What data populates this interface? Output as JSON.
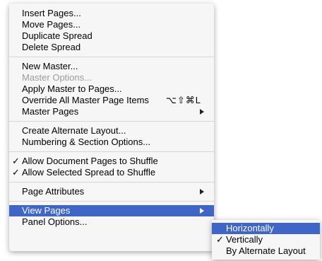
{
  "menu": {
    "group1": [
      "Insert Pages...",
      "Move Pages...",
      "Duplicate Spread",
      "Delete Spread"
    ],
    "group2": {
      "new_master": "New Master...",
      "master_options": "Master Options...",
      "apply_master": "Apply Master to Pages...",
      "override_all": "Override All Master Page Items",
      "override_shortcut": "⌥⇧⌘L",
      "master_pages": "Master Pages"
    },
    "group3": [
      "Create Alternate Layout...",
      "Numbering & Section Options..."
    ],
    "group4": {
      "allow_doc_shuffle": "Allow Document Pages to Shuffle",
      "allow_spread_shuffle": "Allow Selected Spread to Shuffle",
      "check": "✓"
    },
    "page_attributes": "Page Attributes",
    "view_pages": "View Pages",
    "panel_options": "Panel Options..."
  },
  "submenu": {
    "items": [
      "Horizontally",
      "Vertically",
      "By Alternate Layout"
    ],
    "check": "✓"
  },
  "colors": {
    "highlight": "#3f65c9",
    "menu_bg": "#f6f6f6",
    "disabled_text": "#9b9b9b"
  }
}
